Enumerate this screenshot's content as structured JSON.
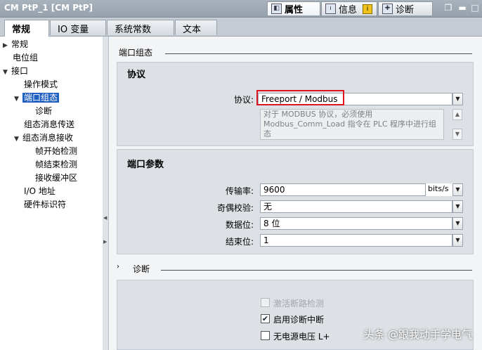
{
  "window": {
    "title": "CM PtP_1 [CM PtP]"
  },
  "inspector_tabs": [
    {
      "label": "属性",
      "icon": "properties-icon"
    },
    {
      "label": "信息",
      "icon": "info-icon"
    },
    {
      "label": "诊断",
      "icon": "diagnostics-icon"
    }
  ],
  "tabs": [
    "常规",
    "IO 变量",
    "系统常数",
    "文本"
  ],
  "sidebar": {
    "items": [
      "常规",
      "电位组",
      "接口",
      "操作模式",
      "端口组态",
      "诊断",
      "组态消息传送",
      "组态消息接收",
      "帧开始检测",
      "帧结束检测",
      "接收缓冲区",
      "I/O 地址",
      "硬件标识符"
    ],
    "selected": "端口组态"
  },
  "main": {
    "heading": "端口组态",
    "protocol_panel": {
      "title": "协议",
      "label": "协议:",
      "value": "Freeport / Modbus",
      "note": "对于 MODBUS 协议，必须使用 Modbus_Comm_Load 指令在 PLC 程序中进行组态"
    },
    "port_panel": {
      "title": "端口参数",
      "baud": {
        "label": "传输率:",
        "value": "9600",
        "unit": "bits/s"
      },
      "parity": {
        "label": "奇偶校验:",
        "value": "无"
      },
      "databits": {
        "label": "数据位:",
        "value": "8 位"
      },
      "stopbits": {
        "label": "结束位:",
        "value": "1"
      }
    },
    "diag_heading": "诊断",
    "diag": {
      "break_detect": {
        "label": "激活断路检测",
        "checked": false,
        "enabled": false
      },
      "diag_interrupt": {
        "label": "启用诊断中断",
        "checked": true,
        "enabled": true
      },
      "no_power": {
        "label": "无电源电压 L+",
        "checked": false,
        "enabled": true
      }
    }
  },
  "watermark": "头条 @跟我动手学电气",
  "colors": {
    "selection": "#1f5fbf",
    "highlight_box": "#e0141e",
    "titlebar": "#9ba6b1"
  }
}
